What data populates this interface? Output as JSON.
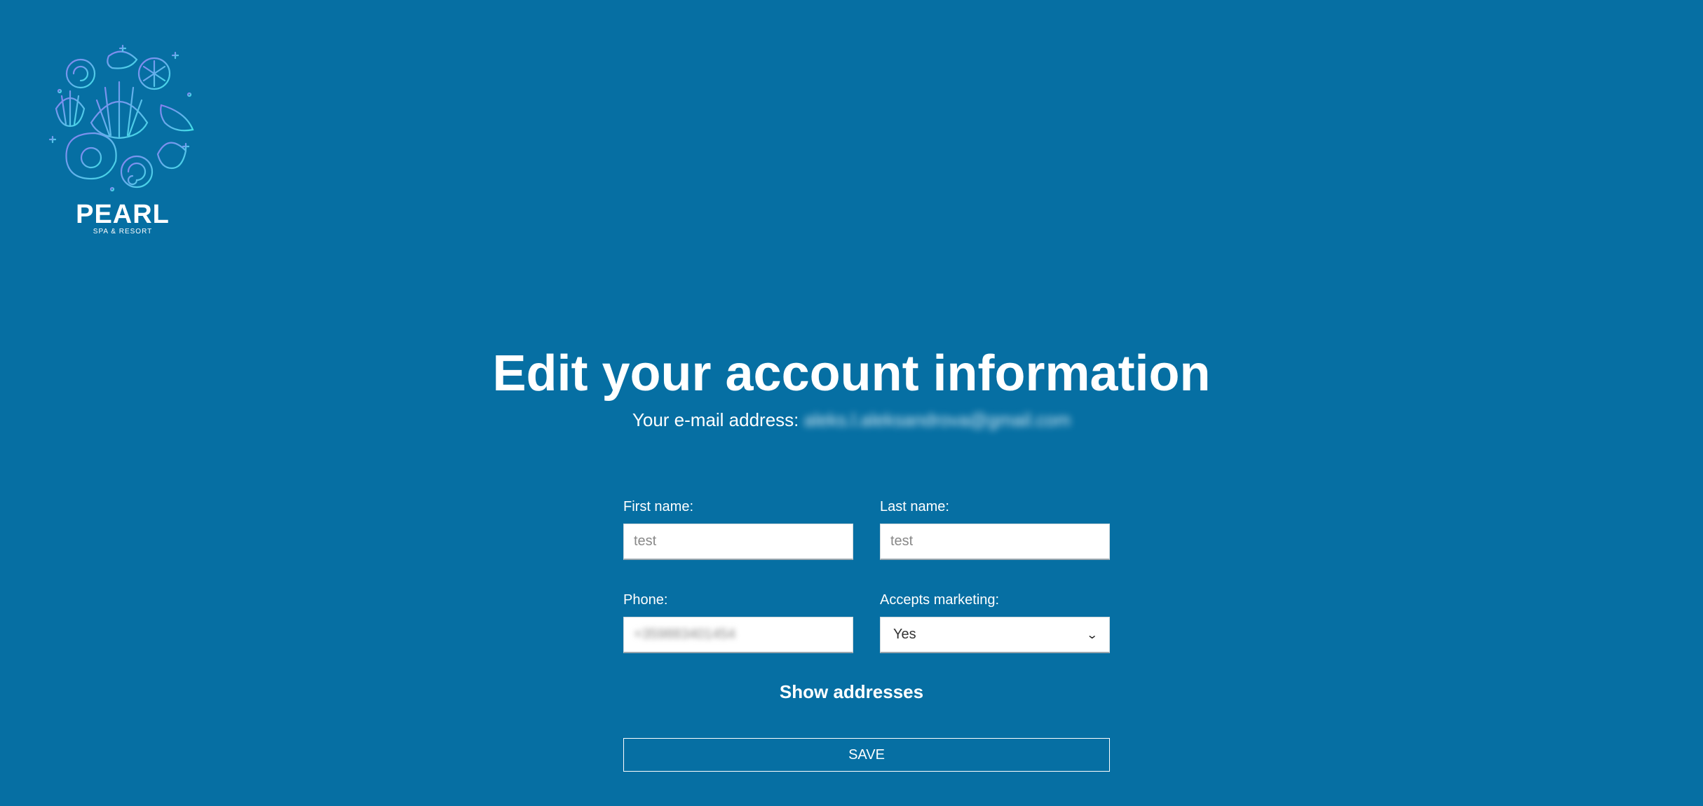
{
  "logo": {
    "name": "PEARL",
    "subtitle": "SPA & RESORT"
  },
  "header": {
    "title": "Edit your account information",
    "email_label": "Your e-mail address: ",
    "email_value": "aleks.l.aleksandrova@gmail.com"
  },
  "form": {
    "first_name": {
      "label": "First name:",
      "value": "test"
    },
    "last_name": {
      "label": "Last name:",
      "value": "test"
    },
    "phone": {
      "label": "Phone:",
      "value": "+359883401454"
    },
    "accepts_marketing": {
      "label": "Accepts marketing:",
      "selected": "Yes"
    },
    "show_addresses_label": "Show addresses",
    "save_label": "SAVE"
  },
  "colors": {
    "background": "#066fa3",
    "text": "#ffffff"
  }
}
